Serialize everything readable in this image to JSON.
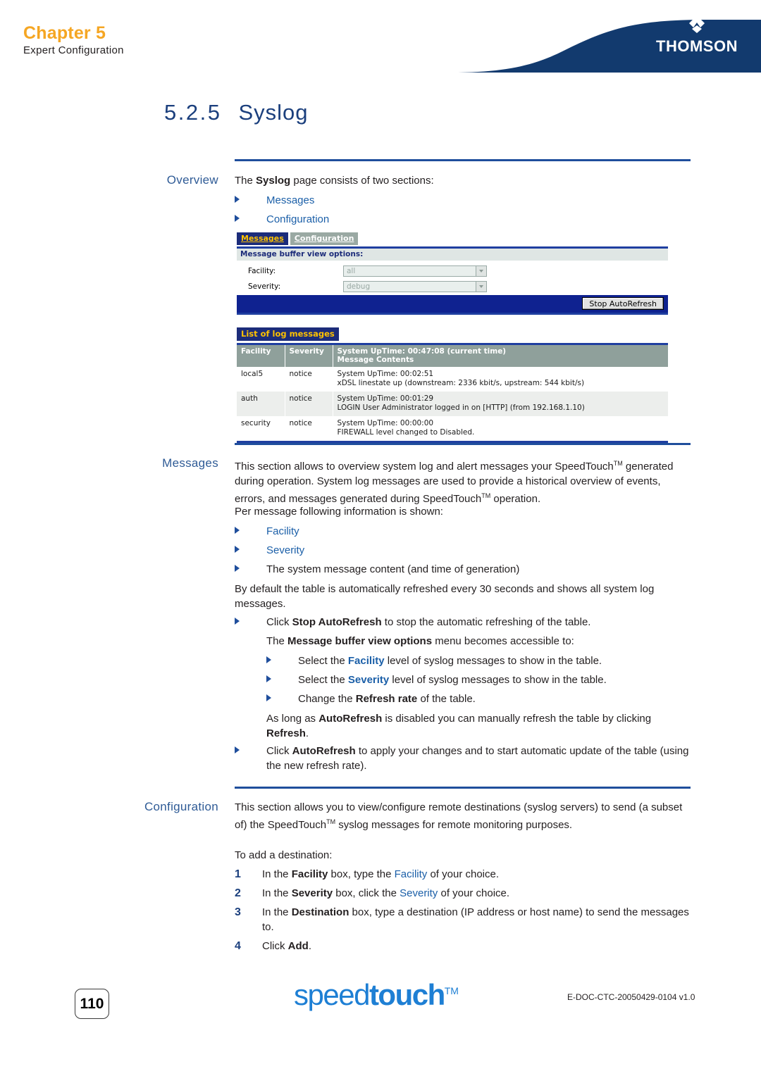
{
  "header": {
    "chapter": "Chapter 5",
    "subtitle": "Expert Configuration",
    "brand": "THOMSON"
  },
  "section": {
    "number": "5.2.5",
    "name": "Syslog"
  },
  "overview": {
    "label": "Overview",
    "intro_pre": "The ",
    "intro_bold": "Syslog",
    "intro_post": " page consists of two sections:",
    "bullets": [
      "Messages",
      "Configuration"
    ]
  },
  "screenshot": {
    "tabs": [
      {
        "label": "Messages",
        "active": true
      },
      {
        "label": "Configuration",
        "active": false
      }
    ],
    "options_bar": "Message buffer view options:",
    "fields": [
      {
        "label": "Facility:",
        "value": "all"
      },
      {
        "label": "Severity:",
        "value": "debug"
      }
    ],
    "button": "Stop AutoRefresh",
    "list_title": "List of log messages",
    "table": {
      "headers": [
        "Facility",
        "Severity"
      ],
      "header_message_line1": "System UpTime: 00:47:08 (current time)",
      "header_message_line2": "Message Contents",
      "rows": [
        {
          "facility": "local5",
          "severity": "notice",
          "uptime": "System UpTime: 00:02:51",
          "message": "xDSL linestate up (downstream: 2336 kbit/s, upstream: 544 kbit/s)"
        },
        {
          "facility": "auth",
          "severity": "notice",
          "uptime": "System UpTime: 00:01:29",
          "message": "LOGIN User Administrator logged in on [HTTP] (from 192.168.1.10)"
        },
        {
          "facility": "security",
          "severity": "notice",
          "uptime": "System UpTime: 00:00:00",
          "message": "FIREWALL level changed to Disabled."
        }
      ]
    }
  },
  "messages": {
    "label": "Messages",
    "para1_a": "This section allows to overview system log and alert messages your SpeedTouch",
    "para1_b": " generated during operation. System log messages are used to provide a historical overview of events, errors, and messages generated during SpeedTouch",
    "para1_c": " operation.",
    "para2": "Per message following information is shown:",
    "bullets": [
      "Facility",
      "Severity",
      "The system message content (and time of generation)"
    ],
    "para3": "By default the table is automatically refreshed every 30 seconds and shows all system log messages.",
    "click_stop_pre": "Click ",
    "click_stop_bold": "Stop AutoRefresh",
    "click_stop_post": " to stop the automatic refreshing of the table.",
    "menu_pre": "The ",
    "menu_bold": "Message buffer view options",
    "menu_post": " menu becomes accessible to:",
    "sub_bullets": [
      {
        "pre": "Select the ",
        "mid": "Facility",
        "post": " level of syslog messages to show in the table."
      },
      {
        "pre": "Select the ",
        "mid": "Severity",
        "post": " level of syslog messages to show in the table."
      },
      {
        "pre": "Change the ",
        "mid": "Refresh rate",
        "post": " of the table."
      }
    ],
    "autorefresh_pre": "As long as ",
    "autorefresh_bold1": "AutoRefresh",
    "autorefresh_mid": " is disabled you can manually refresh the table by clicking ",
    "autorefresh_bold2": "Refresh",
    "autorefresh_post": ".",
    "click_auto_pre": "Click ",
    "click_auto_bold": "AutoRefresh",
    "click_auto_post": " to apply your changes and to start automatic update of the table (using the new refresh rate)."
  },
  "configuration": {
    "label": "Configuration",
    "para1_a": "This section allows you to view/configure remote destinations (syslog servers) to send (a subset of) the SpeedTouch",
    "para1_b": " syslog messages for remote monitoring purposes.",
    "para2": "To add a destination:",
    "steps": [
      {
        "n": "1",
        "pre": "In the ",
        "bold": "Facility",
        "mid": " box, type the ",
        "link": "Facility",
        "post": " of your choice."
      },
      {
        "n": "2",
        "pre": "In the ",
        "bold": "Severity",
        "mid": " box, click the ",
        "link": "Severity",
        "post": " of your choice."
      },
      {
        "n": "3",
        "pre": "In the ",
        "bold": "Destination",
        "mid": " box, type a destination (IP address or host name) to send the messages to.",
        "link": "",
        "post": ""
      },
      {
        "n": "4",
        "pre": "Click ",
        "bold": "Add",
        "mid": ".",
        "link": "",
        "post": ""
      }
    ]
  },
  "footer": {
    "page_number": "110",
    "logo_light": "speed",
    "logo_bold": "touch",
    "logo_tm": "TM",
    "doc_code": "E-DOC-CTC-20050429-0104 v1.0"
  },
  "colors": {
    "brand_blue": "#123a6e",
    "accent_orange": "#f5a623",
    "rule_blue": "#1f4e9c",
    "link_blue": "#1b5fa8"
  }
}
